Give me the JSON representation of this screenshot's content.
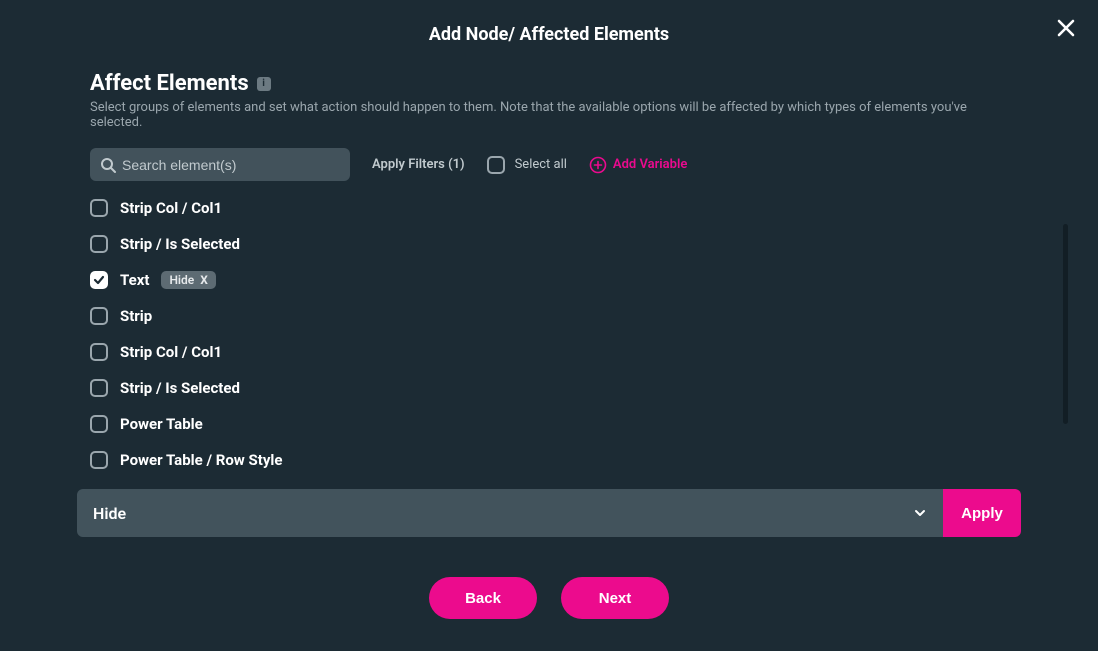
{
  "modal": {
    "title": "Add Node/ Affected Elements"
  },
  "section": {
    "title": "Affect Elements",
    "info": "i",
    "description": "Select groups of elements and set what action should happen to them. Note that the available options will be affected by which types of elements you've selected."
  },
  "toolbar": {
    "search_placeholder": "Search element(s)",
    "apply_filters": "Apply Filters (1)",
    "select_all": "Select all",
    "add_variable": "Add Variable"
  },
  "elements": [
    {
      "label": "Strip Col / Col1",
      "checked": false,
      "tag": null
    },
    {
      "label": "Strip / Is Selected",
      "checked": false,
      "tag": null
    },
    {
      "label": "Text",
      "checked": true,
      "tag": "Hide"
    },
    {
      "label": "Strip",
      "checked": false,
      "tag": null
    },
    {
      "label": "Strip Col / Col1",
      "checked": false,
      "tag": null
    },
    {
      "label": "Strip / Is Selected",
      "checked": false,
      "tag": null
    },
    {
      "label": "Power Table",
      "checked": false,
      "tag": null
    },
    {
      "label": "Power Table / Row Style",
      "checked": false,
      "tag": null
    }
  ],
  "action_bar": {
    "selected": "Hide",
    "apply": "Apply"
  },
  "footer": {
    "back": "Back",
    "next": "Next"
  }
}
